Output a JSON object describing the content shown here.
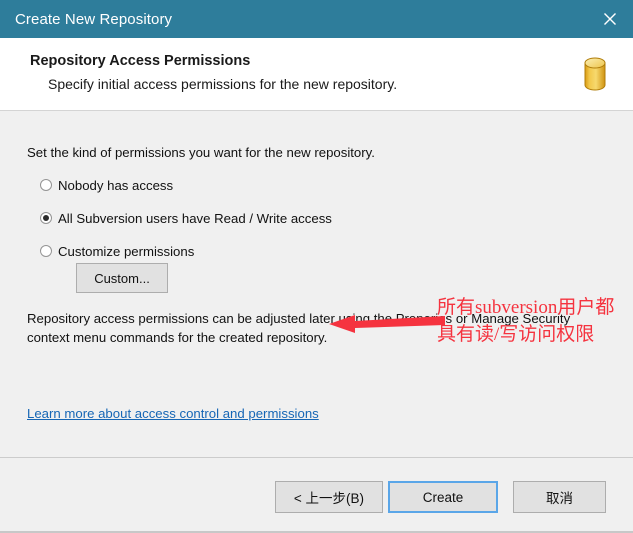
{
  "titlebar": {
    "title": "Create New Repository",
    "close_icon": "close-icon"
  },
  "header": {
    "title": "Repository Access Permissions",
    "subtitle": "Specify initial access permissions for the new repository.",
    "icon": "repository-database-icon"
  },
  "body": {
    "intro": "Set the kind of permissions you want for the new repository.",
    "options": [
      {
        "label": "Nobody has access",
        "checked": false
      },
      {
        "label": "All Subversion users have Read / Write access",
        "checked": true
      },
      {
        "label": "Customize permissions",
        "checked": false
      }
    ],
    "custom_button": "Custom...",
    "note": "Repository access permissions can be adjusted later using the Properies or Manage Security context menu commands for the created repository.",
    "learn_more_link": "Learn more about access control and permissions"
  },
  "annotation": {
    "text": "所有subversion用户都具有读/写访问权限",
    "color": "#f5333f",
    "arrow": "left-arrow-icon"
  },
  "footer": {
    "back_label": "< 上一步(B)",
    "create_label": "Create",
    "cancel_label": "取消"
  },
  "colors": {
    "titlebar": "#2e7d9b",
    "body": "#f0f0f0",
    "link": "#1666b5",
    "accent_focus": "#5aa6e8",
    "annotation_red": "#f5333f",
    "icon_gold": "#e8b933"
  }
}
